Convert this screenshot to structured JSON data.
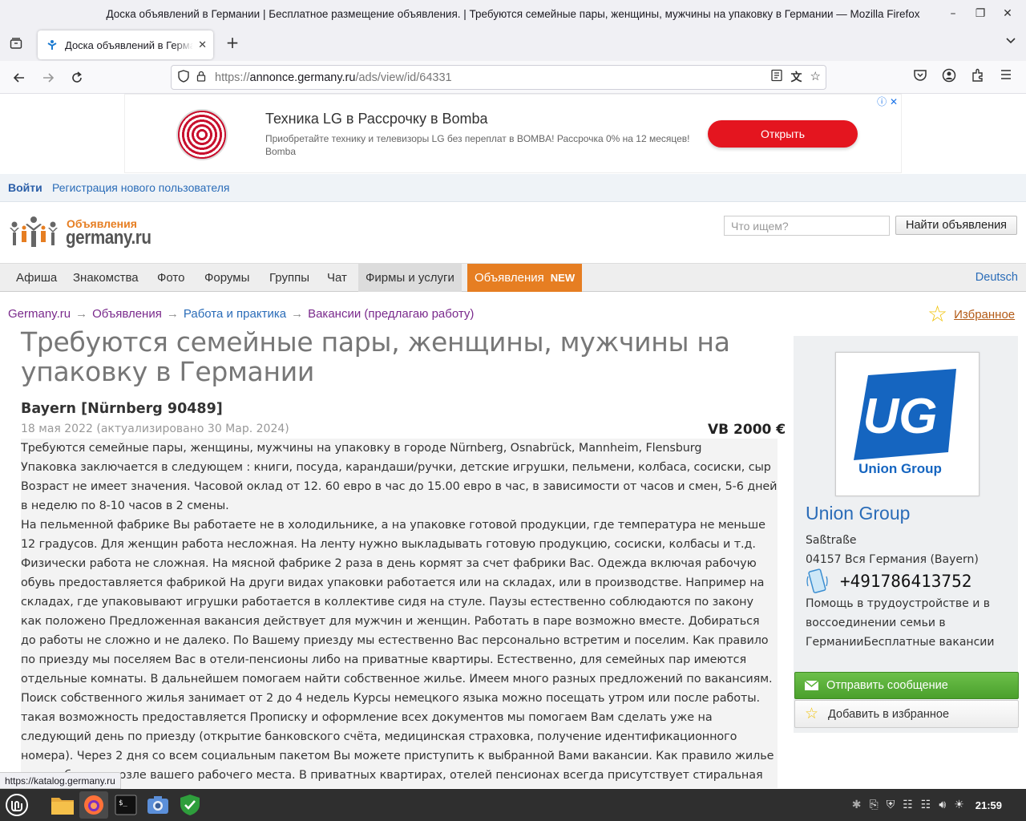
{
  "window": {
    "title": "Доска объявлений в Германии | Бесплатное размещение объявления. | Требуются семейные пары, женщины, мужчины на упаковку в Германии — Mozilla Firefox",
    "controls": [
      "minimize-icon",
      "restore-icon",
      "close-icon"
    ]
  },
  "tabs": [
    {
      "title": "Доска объявлений в Германии | Бесплатное",
      "active": true
    }
  ],
  "url": {
    "prefix": "https://",
    "domain": "annonce.germany.ru",
    "path": "/ads/view/id/64331"
  },
  "ad_banner": {
    "title": "Техника LG в Рассрочку в Bomba",
    "description": "Приобретайте технику и телевизоры LG без переплат в BOMBA! Рассрочка 0% на 12 месяцев! Bomba",
    "button": "Открыть",
    "button_color": "#e4151f"
  },
  "auth": {
    "login": "Войти",
    "register": "Регистрация нового пользователя"
  },
  "logo": {
    "top": "Объявления",
    "main": "germany.ru",
    "accent_color": "#e67e22"
  },
  "search": {
    "placeholder": "Что ищем?",
    "button": "Найти объявления"
  },
  "menu": {
    "items": [
      "Афиша",
      "Знакомства",
      "Фото",
      "Форумы",
      "Группы",
      "Чат",
      "Фирмы и услуги"
    ],
    "active": "Объявления",
    "active_badge": "NEW",
    "language": "Deutsch"
  },
  "breadcrumb": [
    "Germany.ru",
    "Объявления",
    "Работа и практика",
    "Вакансии (предлагаю работу)"
  ],
  "favorites_link": "Избранное",
  "listing": {
    "title": "Требуются семейные пары, женщины, мужчины на упаковку в Германии",
    "location": "Bayern [Nürnberg 90489]",
    "dates": "18 мая 2022 (актуализировано 30 Мар. 2024)",
    "price": "VB 2000 €",
    "paragraphs": [
      "Требуются семейные пары, женщины, мужчины на упаковку в городе Nürnberg, Osnabrück, Mannheim, Flensburg",
      "Упаковка заключается в следующем : книги, посуда, карандаши/ручки, детские игрушки, пельмени, колбаса, сосиски, сыр Возраст не имеет значения. Часовой оклад от 12. 60 евро в час до 15.00 евро в час, в зависимости от часов и смен, 5-6 дней в неделю по 8-10 часов в 2 смены.",
      "На пельменной фабрике Вы работаете не в холодильнике, а на упаковке готовой продукции, где температура не меньше 12 градусов. Для женщин работа несложная. На ленту нужно выкладывать готовую продукцию, сосиски, колбасы и т.д. Физически работа не сложная. На мясной фабрике 2 раза в день кормят за счет фабрики Вас. Одежда включая рабочую обувь предоставляется фабрикой На други видах упаковки работается или на складах, или в производстве. Например на складах, где упаковывают игрушки работается в коллективе сидя на стуле. Паузы естественно соблюдаются по закону как положено Предложенная вакансия действует для мужчин и женщин. Работать в паре возможно вместе. Добираться до работы не сложно и не далеко. По Вашему приезду мы естественно Вас персонально встретим и поселим. Как правило по приезду мы поселяем Вас в отели-пенсионы либо на приватные квартиры. Естественно, для семейных пар имеются отдельные комнаты. В дальнейшем помогаем найти собственное жилье. Имеем много разных предложений по вакансиям.",
      "Поиск собственного жилья занимает от 2 до 4 недель Курсы немецкого языка можно посещать утром или после работы. такая возможность предоставляется Прописку и оформление всех документов мы помогаем Вам сделать уже на следующий день по приезду (открытие банковского счёта, медицинская страховка, получение идентификационного номера). Через 2 дня со всем социальным пакетом Вы можете приступить к выбранной Вами вакансии. Как правило жилье мы подбираем возле вашего рабочего места. В приватных квартирах, отелей пенсионах всегда присутствует стиральная машинка, интернет, холодильник, кухня. С собой"
    ]
  },
  "company": {
    "logo_text": "Union Group",
    "logo_color": "#1565c0",
    "name": "Union Group",
    "street": "Saßtraße",
    "city": "04157 Вся Германия (Bayern)",
    "phone": "+491786413752",
    "about": "Помощь в трудоустройстве и в воссоединении семьи в ГерманииБесплатные вакансии"
  },
  "actions": {
    "send_message": "Отправить сообщение",
    "add_favorite": "Добавить в избранное",
    "send_color": "#5cb43a"
  },
  "status_url": "https://katalog.germany.ru",
  "taskbar": {
    "apps": [
      "mint-menu-icon",
      "files-icon",
      "firefox-icon",
      "terminal-icon",
      "screenshot-icon",
      "shield-icon"
    ],
    "tray_icons": [
      "bluetooth-icon",
      "clipboard-icon",
      "shield-tray-icon",
      "notes-icon",
      "network-icon",
      "volume-icon",
      "brightness-icon"
    ],
    "clock": "21:59"
  }
}
